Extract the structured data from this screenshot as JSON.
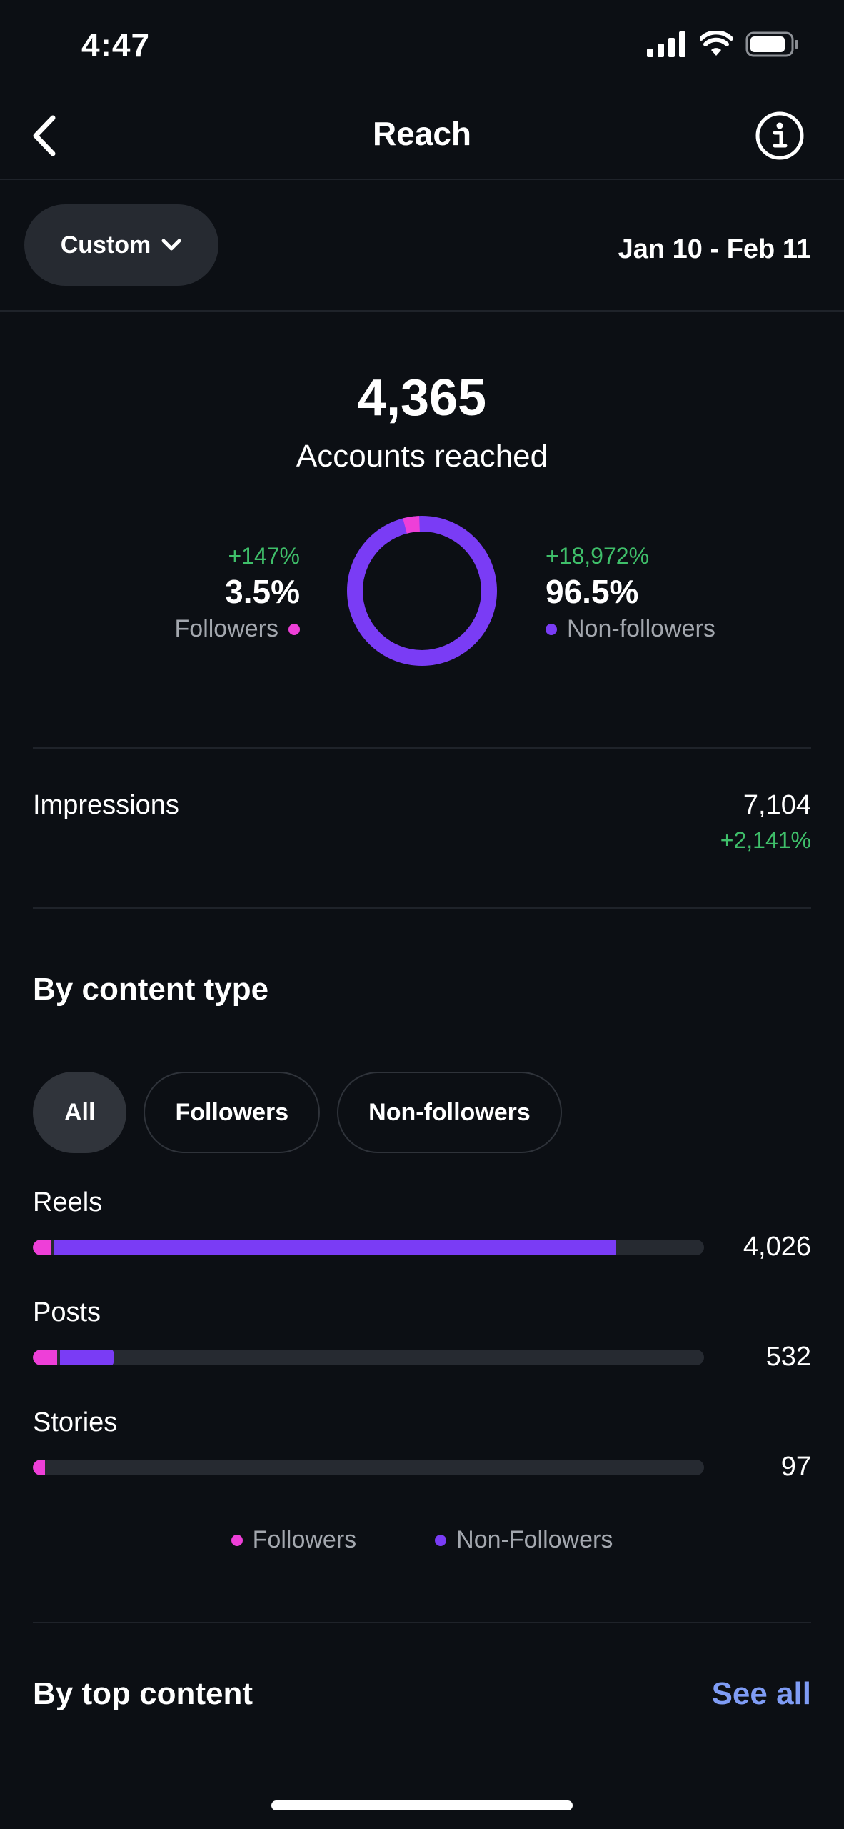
{
  "status_bar": {
    "time": "4:47",
    "icons": [
      "signal-icon",
      "wifi-icon",
      "battery-icon"
    ]
  },
  "header": {
    "title": "Reach",
    "back_icon": "chevron-left-icon",
    "info_icon": "info-icon"
  },
  "filter": {
    "period_label": "Custom",
    "date_range": "Jan 10 - Feb 11"
  },
  "overview": {
    "accounts_reached": "4,365",
    "accounts_reached_label": "Accounts reached",
    "followers": {
      "delta": "+147%",
      "percent": "3.5%",
      "label": "Followers",
      "fraction": 0.035
    },
    "non_followers": {
      "delta": "+18,972%",
      "percent": "96.5%",
      "label": "Non-followers",
      "fraction": 0.965
    }
  },
  "impressions": {
    "label": "Impressions",
    "value": "7,104",
    "delta": "+2,141%"
  },
  "content_type": {
    "title": "By content type",
    "chips": [
      "All",
      "Followers",
      "Non-followers"
    ],
    "active_chip": "All",
    "rows": [
      {
        "label": "Reels",
        "value": "4,026",
        "followers_fraction": 0.028,
        "non_followers_fraction": 0.837
      },
      {
        "label": "Posts",
        "value": "532",
        "followers_fraction": 0.036,
        "non_followers_fraction": 0.08
      },
      {
        "label": "Stories",
        "value": "97",
        "followers_fraction": 0.018,
        "non_followers_fraction": 0.0
      }
    ],
    "legend": {
      "followers": "Followers",
      "non_followers": "Non-Followers"
    }
  },
  "top_content": {
    "title": "By top content",
    "see_all": "See all"
  },
  "colors": {
    "background": "#0c0f14",
    "followers": "#ee3fd8",
    "non_followers": "#7a3cf5",
    "positive": "#3fbf6a",
    "link": "#7f9cf5"
  }
}
